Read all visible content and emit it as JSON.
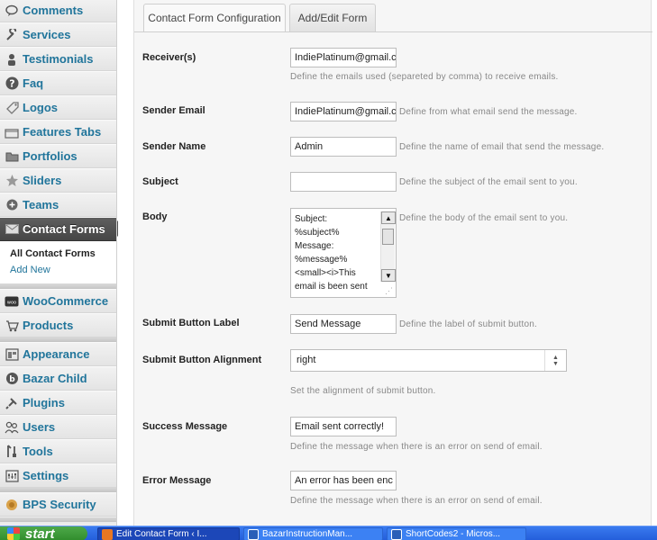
{
  "sidebar": {
    "items": [
      {
        "label": "Comments",
        "icon": "comment-bubble-icon"
      },
      {
        "label": "Services",
        "icon": "wrench-icon"
      },
      {
        "label": "Testimonials",
        "icon": "person-icon"
      },
      {
        "label": "Faq",
        "icon": "question-icon"
      },
      {
        "label": "Logos",
        "icon": "tag-icon"
      },
      {
        "label": "Features Tabs",
        "icon": "tabs-icon"
      },
      {
        "label": "Portfolios",
        "icon": "folder-icon"
      },
      {
        "label": "Sliders",
        "icon": "star-icon"
      },
      {
        "label": "Teams",
        "icon": "plus-circle-icon"
      },
      {
        "label": "Contact Forms",
        "icon": "envelope-icon"
      },
      {
        "label": "WooCommerce",
        "icon": "woocommerce-icon"
      },
      {
        "label": "Products",
        "icon": "cart-icon"
      },
      {
        "label": "Appearance",
        "icon": "appearance-icon"
      },
      {
        "label": "Bazar Child",
        "icon": "bazar-icon"
      },
      {
        "label": "Plugins",
        "icon": "plug-icon"
      },
      {
        "label": "Users",
        "icon": "users-icon"
      },
      {
        "label": "Tools",
        "icon": "tools-icon"
      },
      {
        "label": "Settings",
        "icon": "settings-icon"
      },
      {
        "label": "BPS Security",
        "icon": "shield-icon"
      }
    ],
    "submenu": {
      "current": "All Contact Forms",
      "add_new": "Add New"
    }
  },
  "tabs": [
    "Contact Form Configuration",
    "Add/Edit Form"
  ],
  "form": {
    "receivers": {
      "label": "Receiver(s)",
      "value": "IndiePlatinum@gmail.co",
      "description": "Define the emails used (separeted by comma) to receive emails."
    },
    "sender_email": {
      "label": "Sender Email",
      "value": "IndiePlatinum@gmail.co",
      "description": "Define from what email send the message."
    },
    "sender_name": {
      "label": "Sender Name",
      "value": "Admin",
      "description": "Define the name of email that send the message."
    },
    "subject": {
      "label": "Subject",
      "value": "",
      "description": "Define the subject of the email sent to you."
    },
    "body": {
      "label": "Body",
      "value": "Subject:\n%subject%\nMessage:\n%message%\n<small><i>This\nemail is been sent",
      "description": "Define the body of the email sent to you."
    },
    "submit_label": {
      "label": "Submit Button Label",
      "value": "Send Message",
      "description": "Define the label of submit button."
    },
    "submit_alignment": {
      "label": "Submit Button Alignment",
      "value": "right",
      "description": "Set the alignment of submit button."
    },
    "success_message": {
      "label": "Success Message",
      "value": "Email sent correctly!",
      "description": "Define the message when there is an error on send of email."
    },
    "error_message": {
      "label": "Error Message",
      "value": "An error has been enc",
      "description": "Define the message when there is an error on send of email."
    }
  },
  "taskbar": {
    "start_label": "start",
    "tasks": [
      "Edit Contact Form ‹ I...",
      "BazarInstructionMan...",
      "ShortCodes2 - Micros..."
    ]
  },
  "colors": {
    "link": "#21759b",
    "active_menu": "#464646",
    "taskbar": "#245edb",
    "start": "#2f8c2b"
  }
}
